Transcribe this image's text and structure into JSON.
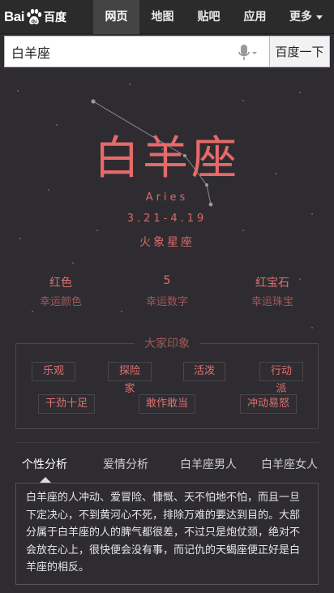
{
  "nav": {
    "logo_text_a": "Bai",
    "logo_text_b": "百度",
    "items": [
      {
        "label": "网页",
        "active": true
      },
      {
        "label": "地图",
        "active": false
      },
      {
        "label": "贴吧",
        "active": false
      },
      {
        "label": "应用",
        "active": false
      },
      {
        "label": "更多",
        "active": false
      }
    ]
  },
  "search": {
    "value": "白羊座",
    "button_label": "百度一下",
    "mic_icon": "microphone-icon"
  },
  "sign": {
    "name": "白羊座",
    "english": "Aries",
    "dates": "3.21-4.19",
    "element": "火象星座"
  },
  "lucky": [
    {
      "value": "红色",
      "label": "幸运颜色"
    },
    {
      "value": "5",
      "label": "幸运数字"
    },
    {
      "value": "红宝石",
      "label": "幸运珠宝"
    }
  ],
  "impressions": {
    "title": "大家印象",
    "tags": [
      "乐观",
      "探险家",
      "活泼",
      "行动派",
      "干劲十足",
      "敢作敢当",
      "冲动易怒"
    ]
  },
  "tabs": [
    "个性分析",
    "爱情分析",
    "白羊座男人",
    "白羊座女人"
  ],
  "analysis": {
    "text": "白羊座的人冲动、爱冒险、慷慨、天不怕地不怕，而且一旦下定决心，不到黄河心不死，排除万难的要达到目的。大部分属于白羊座的人的脾气都很差，不过只是炮仗颈，绝对不会放在心上，很快便会没有事，而记仇的天蝎座便正好是白羊座的相反。"
  },
  "colors": {
    "accent": "#e66a6a",
    "background": "#2e2c31"
  }
}
